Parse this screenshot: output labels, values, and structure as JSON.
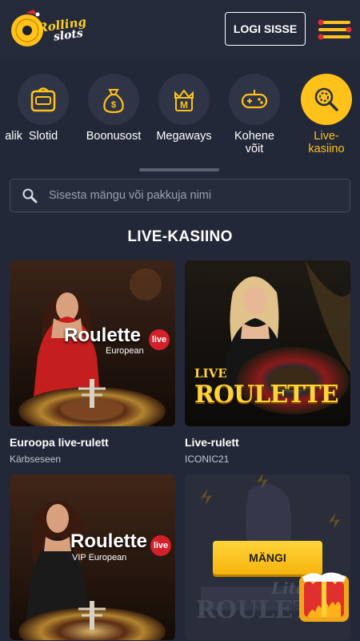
{
  "header": {
    "logo_line1": "Rolling",
    "logo_line2": "slots",
    "login_label": "LOGI SISSE"
  },
  "categories": [
    {
      "label": "alik",
      "icon": "partial-icon"
    },
    {
      "label": "Slotid",
      "icon": "slot-machine-icon"
    },
    {
      "label": "Boonusost",
      "icon": "money-bag-icon"
    },
    {
      "label": "Megaways",
      "icon": "megaways-crown-icon"
    },
    {
      "label": "Kohene\nvõit",
      "icon": "gamepad-icon"
    },
    {
      "label": "Live-\nkasiino",
      "icon": "magnifier-chip-icon",
      "active": true
    }
  ],
  "search": {
    "placeholder": "Sisesta mängu või pakkuja nimi"
  },
  "section_title": "LIVE-KASIINO",
  "games": [
    {
      "name": "Euroopa live-rulett",
      "provider": "Kärbseseen",
      "art_title": "Roulette",
      "art_sub": "European",
      "badge": "live"
    },
    {
      "name": "Live-rulett",
      "provider": "ICONIC21",
      "art_title": "ROULETTE",
      "art_sub": "LIVE"
    },
    {
      "name": "",
      "provider": "",
      "art_title": "Roulette",
      "art_sub": "VIP European",
      "badge": "live"
    },
    {
      "name": "",
      "provider": "",
      "art_title": "ROULETTE",
      "art_sub": "Lite"
    }
  ],
  "play_label": "MÄNGI",
  "colors": {
    "accent": "#ffc21a",
    "background": "#232838",
    "card": "#2f3547"
  }
}
